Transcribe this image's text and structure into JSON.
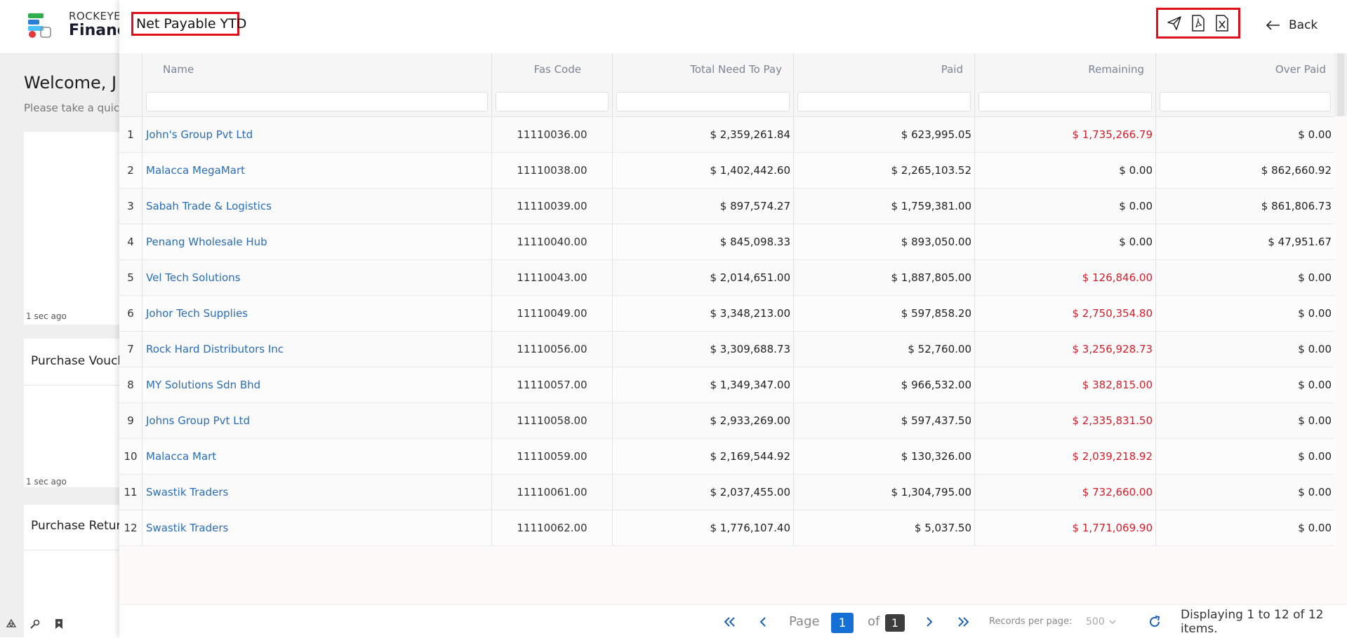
{
  "background": {
    "brand_top": "ROCKEYE",
    "brand_bottom": "Finance",
    "welcome": "Welcome, J",
    "subtitle": "Please take a quick",
    "cards": [
      {
        "title": "",
        "time": "1 sec ago"
      },
      {
        "title": "Purchase Vouch",
        "time": "1 sec ago"
      },
      {
        "title": "Purchase Return",
        "time": ""
      }
    ]
  },
  "panel": {
    "title": "Net Payable YTD",
    "actions": [
      {
        "name": "send-icon"
      },
      {
        "name": "pdf-icon"
      },
      {
        "name": "excel-icon"
      }
    ],
    "back_label": "Back"
  },
  "table": {
    "columns": [
      "Name",
      "Fas Code",
      "Total Need To Pay",
      "Paid",
      "Remaining",
      "Over Paid"
    ],
    "rows": [
      {
        "num": "1",
        "name": "John's Group Pvt Ltd",
        "code": "11110036.00",
        "total": "$ 2,359,261.84",
        "paid": "$ 623,995.05",
        "remaining": "$ 1,735,266.79",
        "rem_neg": true,
        "over": "$ 0.00"
      },
      {
        "num": "2",
        "name": "Malacca MegaMart",
        "code": "11110038.00",
        "total": "$ 1,402,442.60",
        "paid": "$ 2,265,103.52",
        "remaining": "$ 0.00",
        "rem_neg": false,
        "over": "$ 862,660.92"
      },
      {
        "num": "3",
        "name": "Sabah Trade & Logistics",
        "code": "11110039.00",
        "total": "$ 897,574.27",
        "paid": "$ 1,759,381.00",
        "remaining": "$ 0.00",
        "rem_neg": false,
        "over": "$ 861,806.73"
      },
      {
        "num": "4",
        "name": "Penang Wholesale Hub",
        "code": "11110040.00",
        "total": "$ 845,098.33",
        "paid": "$ 893,050.00",
        "remaining": "$ 0.00",
        "rem_neg": false,
        "over": "$ 47,951.67"
      },
      {
        "num": "5",
        "name": "Vel Tech Solutions",
        "code": "11110043.00",
        "total": "$ 2,014,651.00",
        "paid": "$ 1,887,805.00",
        "remaining": "$ 126,846.00",
        "rem_neg": true,
        "over": "$ 0.00"
      },
      {
        "num": "6",
        "name": "Johor Tech Supplies",
        "code": "11110049.00",
        "total": "$ 3,348,213.00",
        "paid": "$ 597,858.20",
        "remaining": "$ 2,750,354.80",
        "rem_neg": true,
        "over": "$ 0.00"
      },
      {
        "num": "7",
        "name": "Rock Hard Distributors Inc",
        "code": "11110056.00",
        "total": "$ 3,309,688.73",
        "paid": "$ 52,760.00",
        "remaining": "$ 3,256,928.73",
        "rem_neg": true,
        "over": "$ 0.00"
      },
      {
        "num": "8",
        "name": "MY Solutions Sdn Bhd",
        "code": "11110057.00",
        "total": "$ 1,349,347.00",
        "paid": "$ 966,532.00",
        "remaining": "$ 382,815.00",
        "rem_neg": true,
        "over": "$ 0.00"
      },
      {
        "num": "9",
        "name": "Johns Group Pvt Ltd",
        "code": "11110058.00",
        "total": "$ 2,933,269.00",
        "paid": "$ 597,437.50",
        "remaining": "$ 2,335,831.50",
        "rem_neg": true,
        "over": "$ 0.00"
      },
      {
        "num": "10",
        "name": "Malacca Mart",
        "code": "11110059.00",
        "total": "$ 2,169,544.92",
        "paid": "$ 130,326.00",
        "remaining": "$ 2,039,218.92",
        "rem_neg": true,
        "over": "$ 0.00"
      },
      {
        "num": "11",
        "name": "Swastik Traders",
        "code": "11110061.00",
        "total": "$ 2,037,455.00",
        "paid": "$ 1,304,795.00",
        "remaining": "$ 732,660.00",
        "rem_neg": true,
        "over": "$ 0.00"
      },
      {
        "num": "12",
        "name": "Swastik Traders",
        "code": "11110062.00",
        "total": "$ 1,776,107.40",
        "paid": "$ 5,037.50",
        "remaining": "$ 1,771,069.90",
        "rem_neg": true,
        "over": "$ 0.00"
      }
    ]
  },
  "pager": {
    "page_label": "Page",
    "current_page": "1",
    "of_label": "of",
    "total_pages": "1",
    "records_label": "Records per page:",
    "records_value": "500",
    "display_text": "Displaying 1 to 12 of 12 items."
  },
  "colors": {
    "highlight": "#e0101a",
    "link": "#2a6db5",
    "negative": "#d41d2b",
    "pager_accent": "#1570d6"
  }
}
